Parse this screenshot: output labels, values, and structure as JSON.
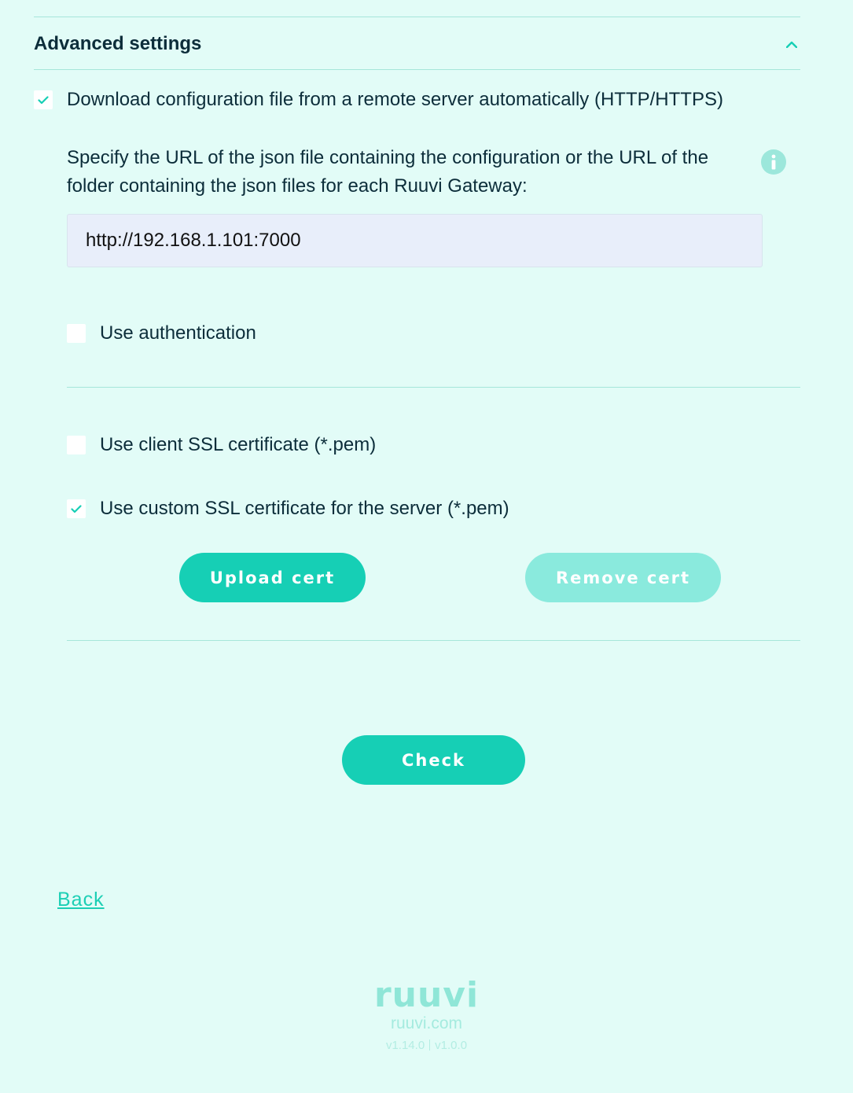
{
  "advanced": {
    "title": "Advanced settings",
    "expanded": true
  },
  "remote_config": {
    "label": "Download configuration file from a remote server automatically (HTTP/HTTPS)",
    "checked": true,
    "description": "Specify the URL of the json file containing the configuration or the URL of the folder containing the json files for each Ruuvi Gateway:",
    "url_value": "http://192.168.1.101:7000"
  },
  "use_auth": {
    "label": "Use authentication",
    "checked": false
  },
  "client_ssl": {
    "label": "Use client SSL certificate (*.pem)",
    "checked": false
  },
  "custom_ssl": {
    "label": "Use custom SSL certificate for the server (*.pem)",
    "checked": true
  },
  "buttons": {
    "upload_cert": "Upload cert",
    "remove_cert": "Remove cert",
    "check": "Check"
  },
  "nav": {
    "back": "Back"
  },
  "footer": {
    "logo": "ruuvi",
    "site": "ruuvi.com",
    "version_fw": "v1.14.0",
    "version_ui": "v1.0.0"
  },
  "colors": {
    "background": "#e2fcf7",
    "accent": "#16cfb5",
    "accent_disabled": "#8aeadd",
    "text": "#0c2d3a"
  },
  "icons": {
    "collapse": "chevron-up-icon",
    "info": "info-icon",
    "check": "checkmark-icon"
  }
}
